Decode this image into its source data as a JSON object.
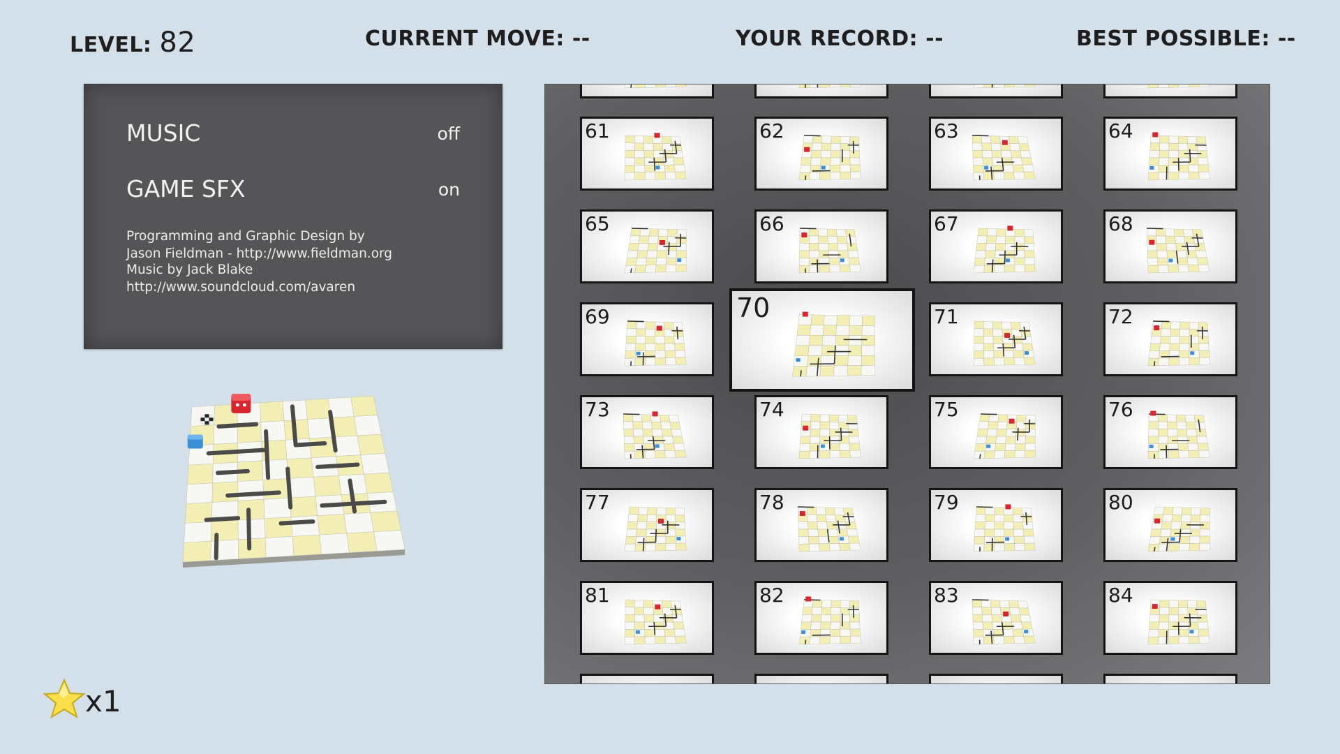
{
  "hud": {
    "level_label": "LEVEL:",
    "level_value": "82",
    "current_move_label": "CURRENT MOVE:",
    "current_move_value": "--",
    "record_label": "YOUR RECORD:",
    "record_value": "--",
    "best_label": "BEST POSSIBLE:",
    "best_value": "--"
  },
  "options": {
    "music_label": "MUSIC",
    "music_value": "off",
    "sfx_label": "GAME SFX",
    "sfx_value": "on",
    "credits_programming_line1": "Programming and Graphic Design by",
    "credits_programming_line2": "Jason Fieldman - http://www.fieldman.org",
    "credits_music_line1": "Music by Jack Blake",
    "credits_music_line2": "http://www.soundcloud.com/avaren"
  },
  "stars": {
    "icon": "star-icon",
    "count_text": "x1"
  },
  "level_select": {
    "selected_level": "70",
    "levels": [
      "61",
      "62",
      "63",
      "64",
      "65",
      "66",
      "67",
      "68",
      "69",
      "70",
      "71",
      "72",
      "73",
      "74",
      "75",
      "76",
      "77",
      "78",
      "79",
      "80",
      "81",
      "82",
      "83",
      "84"
    ],
    "partial_top_row_visible": true,
    "partial_bottom_row_visible": true
  },
  "colors": {
    "background": "#d3e0ea",
    "panel": "#555558",
    "tile_yellow": "#f2eeb4",
    "tile_white": "#f7f7f4",
    "player_red": "#d8262e",
    "player_blue": "#3a8fd6"
  }
}
